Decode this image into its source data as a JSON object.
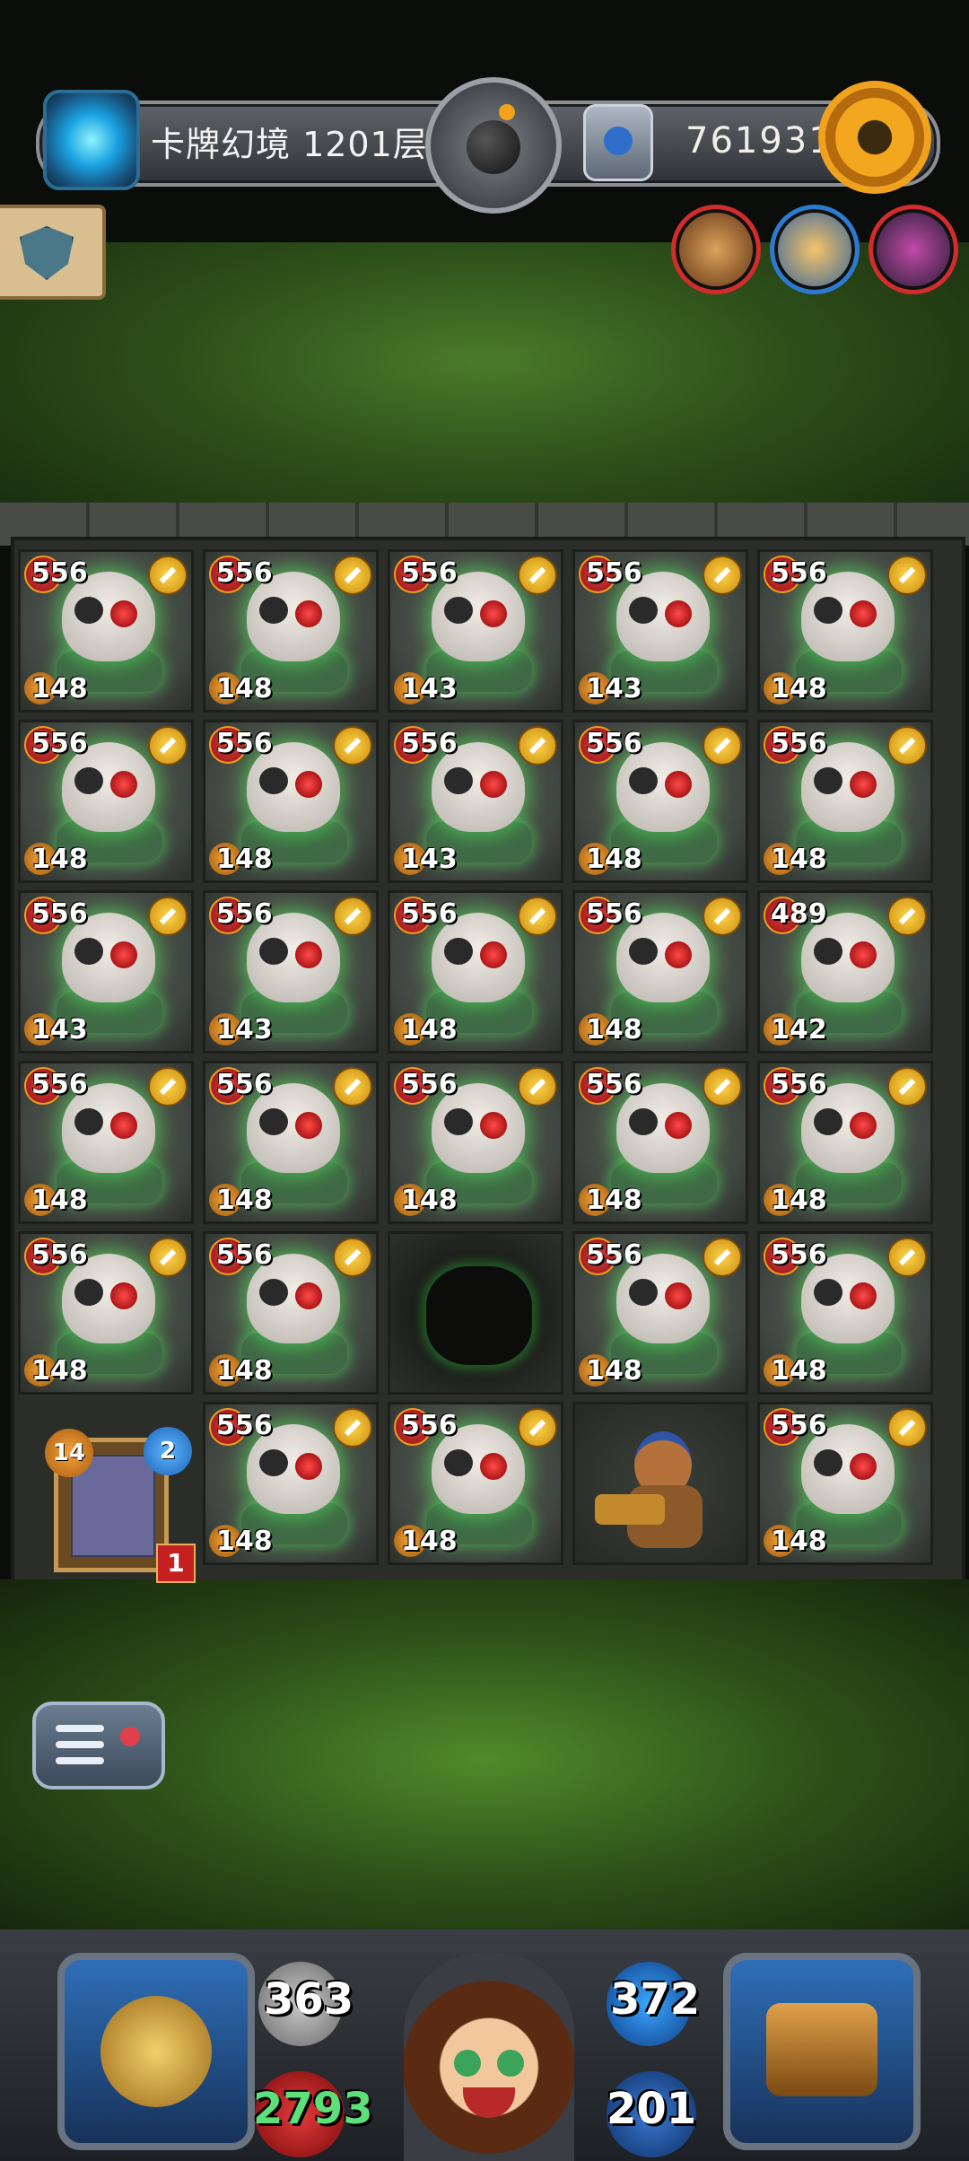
{
  "header": {
    "level_text": "卡牌幻境 1201层",
    "gold_text": "761931",
    "icons": {
      "portal": "portal-icon",
      "bomb": "bomb-medal-icon",
      "crest": "crest-icon",
      "settings": "gear-icon"
    }
  },
  "heroes": [
    {
      "name": "hammer-hero-portrait"
    },
    {
      "name": "blond-hero-portrait"
    },
    {
      "name": "dark-hero-portrait"
    }
  ],
  "board": {
    "rows": [
      [
        {
          "atk": "556",
          "hp": "148"
        },
        {
          "atk": "556",
          "hp": "148"
        },
        {
          "atk": "556",
          "hp": "143"
        },
        {
          "atk": "556",
          "hp": "143"
        },
        {
          "atk": "556",
          "hp": "148"
        }
      ],
      [
        {
          "atk": "556",
          "hp": "148"
        },
        {
          "atk": "556",
          "hp": "148"
        },
        {
          "atk": "556",
          "hp": "143"
        },
        {
          "atk": "556",
          "hp": "148"
        },
        {
          "atk": "556",
          "hp": "148"
        }
      ],
      [
        {
          "atk": "556",
          "hp": "143"
        },
        {
          "atk": "556",
          "hp": "143"
        },
        {
          "atk": "556",
          "hp": "148"
        },
        {
          "atk": "556",
          "hp": "148"
        },
        {
          "atk": "489",
          "hp": "142"
        }
      ],
      [
        {
          "atk": "556",
          "hp": "148"
        },
        {
          "atk": "556",
          "hp": "148"
        },
        {
          "atk": "556",
          "hp": "148"
        },
        {
          "atk": "556",
          "hp": "148"
        },
        {
          "atk": "556",
          "hp": "148"
        }
      ],
      [
        {
          "atk": "556",
          "hp": "148"
        },
        {
          "atk": "556",
          "hp": "148"
        },
        null,
        {
          "atk": "556",
          "hp": "148"
        },
        {
          "atk": "556",
          "hp": "148"
        }
      ],
      [
        {
          "card": true
        },
        {
          "atk": "556",
          "hp": "148"
        },
        {
          "atk": "556",
          "hp": "148"
        },
        {
          "player": true
        },
        {
          "atk": "556",
          "hp": "148"
        }
      ]
    ]
  },
  "card_stack": {
    "top_left": "14",
    "top_right": "2",
    "bottom_right": "1"
  },
  "hud": {
    "attack": "363",
    "hp": "2793",
    "defense": "372",
    "mana": "201",
    "colors": {
      "hp": "#5de07a",
      "text": "#ffffff",
      "accent": "#f3a71f"
    }
  }
}
